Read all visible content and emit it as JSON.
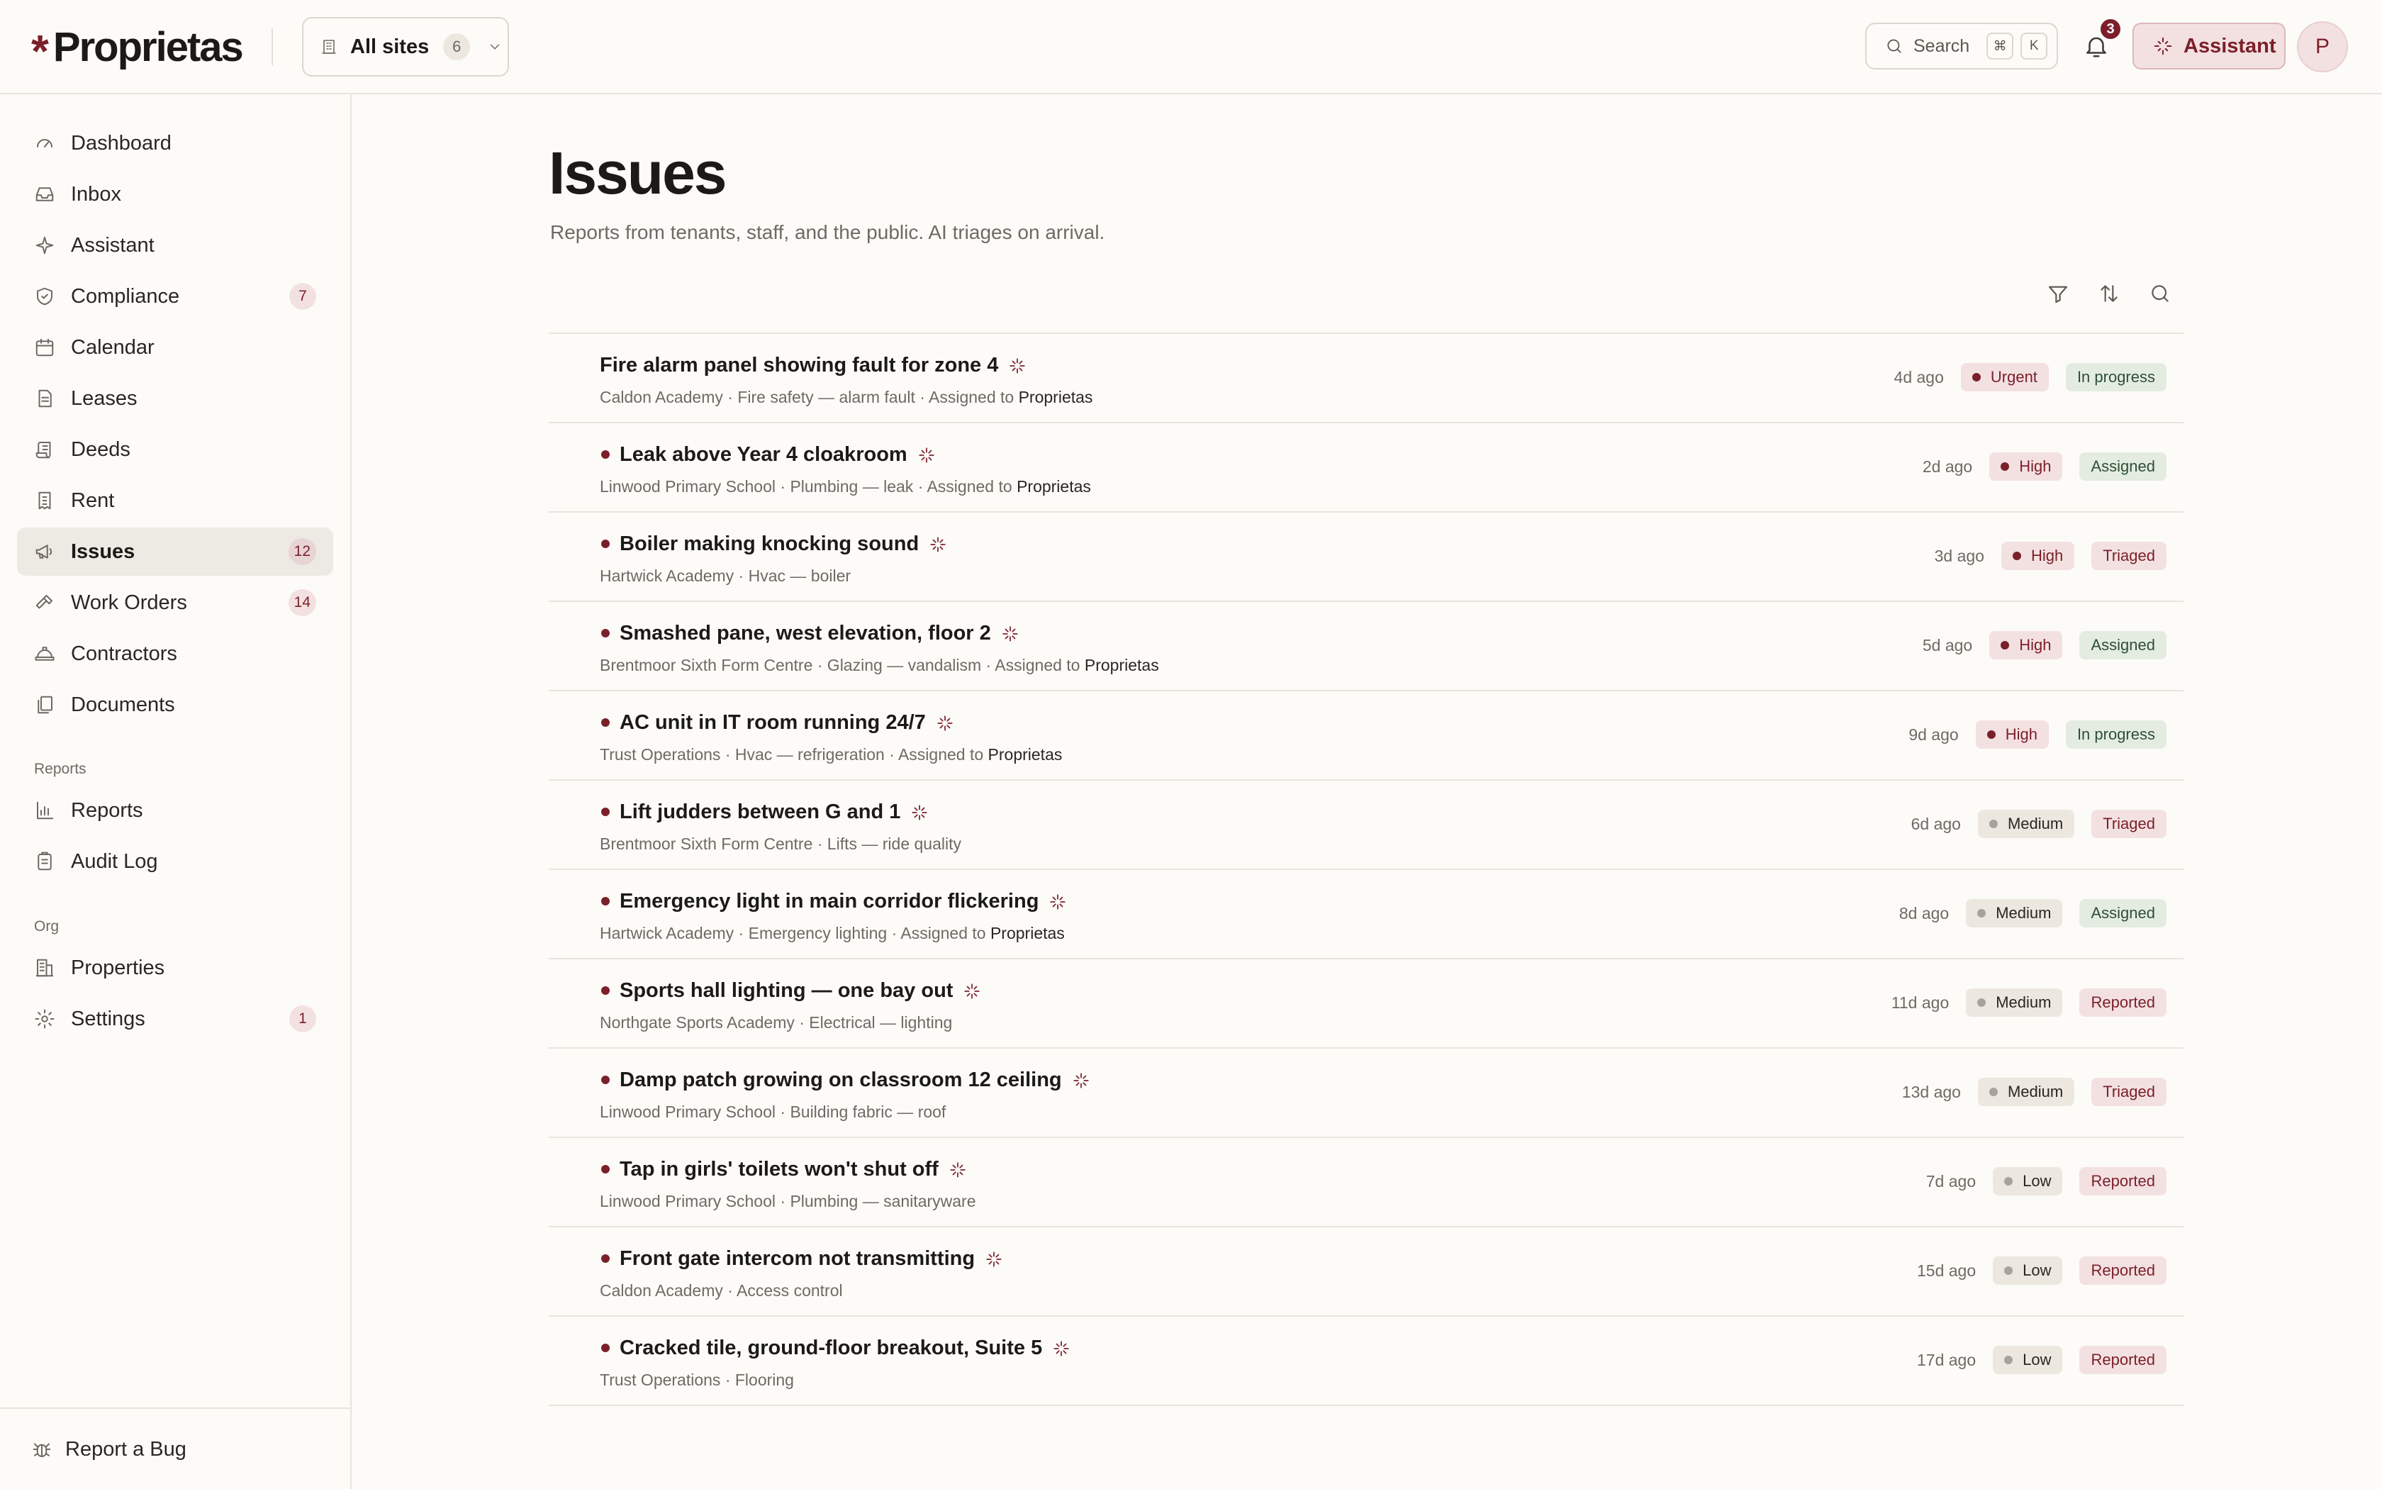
{
  "header": {
    "logo_text": "Proprietas",
    "sites_label": "All sites",
    "sites_count": "6",
    "search_label": "Search",
    "search_kbd": [
      "⌘",
      "K"
    ],
    "notifications_count": "3",
    "assistant_label": "Assistant",
    "avatar_initial": "P",
    "accent_color": "#7b1f2a"
  },
  "sidebar": {
    "items": [
      {
        "label": "Dashboard",
        "icon": "gauge-icon",
        "count": ""
      },
      {
        "label": "Inbox",
        "icon": "inbox-icon",
        "count": ""
      },
      {
        "label": "Assistant",
        "icon": "sparkle-icon",
        "count": ""
      },
      {
        "label": "Compliance",
        "icon": "shield-check-icon",
        "count": "7"
      },
      {
        "label": "Calendar",
        "icon": "calendar-icon",
        "count": ""
      },
      {
        "label": "Leases",
        "icon": "document-icon",
        "count": ""
      },
      {
        "label": "Deeds",
        "icon": "scroll-icon",
        "count": ""
      },
      {
        "label": "Rent",
        "icon": "receipt-icon",
        "count": ""
      },
      {
        "label": "Issues",
        "icon": "megaphone-icon",
        "count": "12",
        "active": true
      },
      {
        "label": "Work Orders",
        "icon": "hammer-icon",
        "count": "14"
      },
      {
        "label": "Contractors",
        "icon": "hard-hat-icon",
        "count": ""
      },
      {
        "label": "Documents",
        "icon": "files-icon",
        "count": ""
      }
    ],
    "reports_section": "Reports",
    "reports_items": [
      {
        "label": "Reports",
        "icon": "bar-chart-icon"
      },
      {
        "label": "Audit Log",
        "icon": "clipboard-icon"
      }
    ],
    "org_section": "Org",
    "org_items": [
      {
        "label": "Properties",
        "icon": "building-icon",
        "count": ""
      },
      {
        "label": "Settings",
        "icon": "gear-icon",
        "count": "1"
      }
    ],
    "report_bug_label": "Report a Bug"
  },
  "main": {
    "title": "Issues",
    "subtitle": "Reports from tenants, staff, and the public. AI triages on arrival.",
    "issues": [
      {
        "title": "Fire alarm panel showing fault for zone 4",
        "unread": false,
        "meta": "Caldon Academy · Fire safety — alarm fault · Assigned to ",
        "assignee": "Proprietas",
        "age": "4d ago",
        "priority": "Urgent",
        "status": "In progress"
      },
      {
        "title": "Leak above Year 4 cloakroom",
        "unread": true,
        "meta": "Linwood Primary School · Plumbing — leak · Assigned to ",
        "assignee": "Proprietas",
        "age": "2d ago",
        "priority": "High",
        "status": "Assigned"
      },
      {
        "title": "Boiler making knocking sound",
        "unread": true,
        "meta": "Hartwick Academy · Hvac — boiler",
        "assignee": "",
        "age": "3d ago",
        "priority": "High",
        "status": "Triaged"
      },
      {
        "title": "Smashed pane, west elevation, floor 2",
        "unread": true,
        "meta": "Brentmoor Sixth Form Centre · Glazing — vandalism · Assigned to ",
        "assignee": "Proprietas",
        "age": "5d ago",
        "priority": "High",
        "status": "Assigned"
      },
      {
        "title": "AC unit in IT room running 24/7",
        "unread": true,
        "meta": "Trust Operations · Hvac — refrigeration · Assigned to ",
        "assignee": "Proprietas",
        "age": "9d ago",
        "priority": "High",
        "status": "In progress"
      },
      {
        "title": "Lift judders between G and 1",
        "unread": true,
        "meta": "Brentmoor Sixth Form Centre · Lifts — ride quality",
        "assignee": "",
        "age": "6d ago",
        "priority": "Medium",
        "status": "Triaged"
      },
      {
        "title": "Emergency light in main corridor flickering",
        "unread": true,
        "meta": "Hartwick Academy · Emergency lighting · Assigned to ",
        "assignee": "Proprietas",
        "age": "8d ago",
        "priority": "Medium",
        "status": "Assigned"
      },
      {
        "title": "Sports hall lighting — one bay out",
        "unread": true,
        "meta": "Northgate Sports Academy · Electrical — lighting",
        "assignee": "",
        "age": "11d ago",
        "priority": "Medium",
        "status": "Reported"
      },
      {
        "title": "Damp patch growing on classroom 12 ceiling",
        "unread": true,
        "meta": "Linwood Primary School · Building fabric — roof",
        "assignee": "",
        "age": "13d ago",
        "priority": "Medium",
        "status": "Triaged"
      },
      {
        "title": "Tap in girls' toilets won't shut off",
        "unread": true,
        "meta": "Linwood Primary School · Plumbing — sanitaryware",
        "assignee": "",
        "age": "7d ago",
        "priority": "Low",
        "status": "Reported"
      },
      {
        "title": "Front gate intercom not transmitting",
        "unread": true,
        "meta": "Caldon Academy · Access control",
        "assignee": "",
        "age": "15d ago",
        "priority": "Low",
        "status": "Reported"
      },
      {
        "title": "Cracked tile, ground-floor breakout, Suite 5",
        "unread": true,
        "meta": "Trust Operations · Flooring",
        "assignee": "",
        "age": "17d ago",
        "priority": "Low",
        "status": "Reported"
      }
    ]
  }
}
